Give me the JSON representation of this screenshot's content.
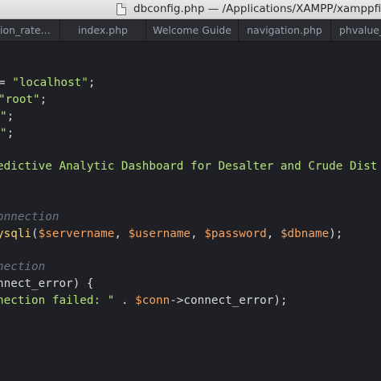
{
  "window": {
    "title": "dbconfig.php — /Applications/XAMPP/xamppfile",
    "icon": "php-file-icon"
  },
  "tabs": [
    {
      "label": "ion_rate..."
    },
    {
      "label": "index.php"
    },
    {
      "label": "Welcome Guide"
    },
    {
      "label": "navigation.php"
    },
    {
      "label": "phvalue_"
    }
  ],
  "code": {
    "line1": {
      "a": "= ",
      "b": "\"localhost\"",
      "c": ";"
    },
    "line2": {
      "a": "\"root\"",
      "b": ";"
    },
    "line3": {
      "a": "\"",
      "b": ";"
    },
    "line4": {
      "a": "\"",
      "b": ";"
    },
    "line5": {
      "a": "edictive Analytic Dashboard for Desalter and Crude Dist"
    },
    "line6": {
      "a": "onnection"
    },
    "line7": {
      "a": "ysqli",
      "b": "(",
      "c": "$servername",
      "d": ", ",
      "e": "$username",
      "f": ", ",
      "g": "$password",
      "h": ", ",
      "i": "$dbname",
      "j": ");"
    },
    "line8": {
      "a": "nection"
    },
    "line9": {
      "a": "nnect_error",
      "b": ") {"
    },
    "line10": {
      "a": "nection failed: \"",
      "b": " . ",
      "c": "$conn",
      "d": "->",
      "e": "connect_error",
      "f": ");"
    }
  },
  "colors": {
    "string": "#b5e07a",
    "comment": "#6d7380",
    "variable": "#f5a25f",
    "function": "#f7d36a",
    "background": "#1e2025"
  }
}
